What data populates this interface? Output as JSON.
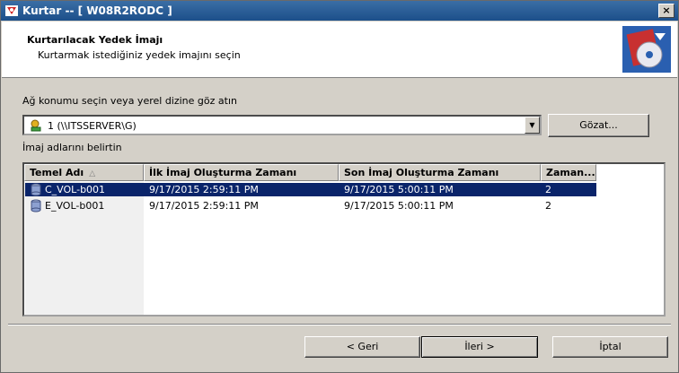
{
  "window": {
    "title": "Kurtar -- [ W08R2RODC ]",
    "close_glyph": "×"
  },
  "header": {
    "title": "Kurtarılacak Yedek İmajı",
    "subtitle": "Kurtarmak istediğiniz yedek imajını seçin"
  },
  "location": {
    "label": "Ağ konumu seçin veya yerel dizine göz atın",
    "selected": "1 (\\\\ITSSERVER\\G)",
    "browse_button": "Gözat..."
  },
  "images": {
    "label": "İmaj adlarını belirtin",
    "columns": [
      "Temel Adı",
      "İlk İmaj Oluşturma Zamanı",
      "Son İmaj Oluşturma Zamanı",
      "Zaman..."
    ],
    "sort_glyph": "△",
    "rows": [
      {
        "name": "C_VOL-b001",
        "first": "9/17/2015 2:59:11 PM",
        "last": "9/17/2015 5:00:11 PM",
        "count": "2",
        "selected": true
      },
      {
        "name": "E_VOL-b001",
        "first": "9/17/2015 2:59:11 PM",
        "last": "9/17/2015 5:00:11 PM",
        "count": "2",
        "selected": false
      }
    ]
  },
  "buttons": {
    "back": "< Geri",
    "next": "İleri >",
    "cancel": "İptal"
  },
  "colors": {
    "title_bar": "#1c4f8a",
    "selection": "#0a246a",
    "dialog_bg": "#d4d0c8"
  },
  "icons": [
    "app-logo-icon",
    "close-icon",
    "backup-disc-icon",
    "network-drive-icon",
    "dropdown-arrow-icon",
    "sort-up-icon",
    "disk-icon"
  ]
}
